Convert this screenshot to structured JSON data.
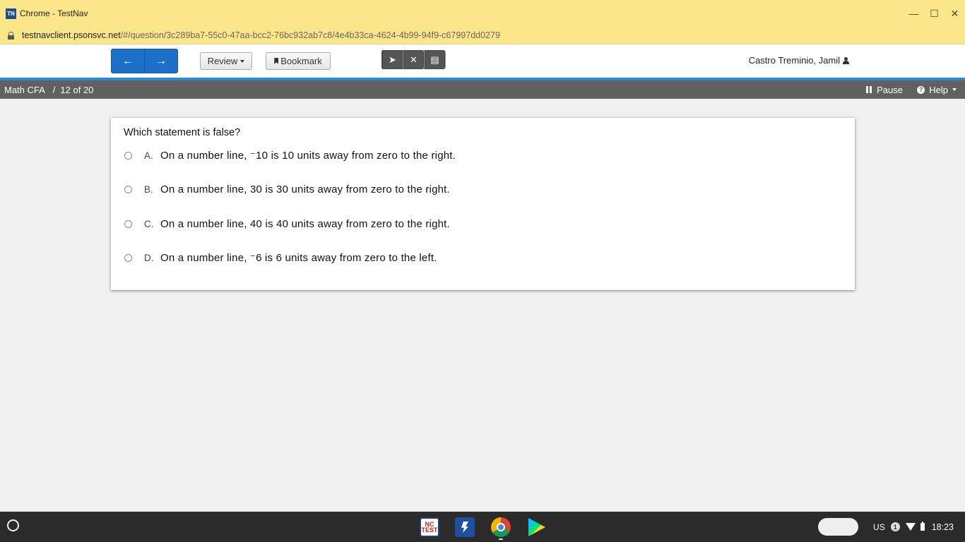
{
  "window": {
    "logo_text": "TN",
    "title": "Chrome - TestNav",
    "controls": {
      "minimize": "—",
      "maximize": "☐",
      "close": "✕"
    }
  },
  "urlbar": {
    "host": "testnavclient.psonsvc.net",
    "path": "/#/question/3c289ba7-55c0-47aa-bcc2-76bc932ab7c8/4e4b33ca-4624-4b99-94f9-c67997dd0279"
  },
  "toolbar": {
    "back_glyph": "←",
    "forward_glyph": "→",
    "review_label": "Review",
    "bookmark_label": "Bookmark",
    "tools": [
      {
        "name": "pointer-tool",
        "glyph": "➤",
        "icon": "pointer-icon"
      },
      {
        "name": "eliminator-tool",
        "glyph": "✕",
        "icon": "answer-eliminator-icon"
      },
      {
        "name": "notepad-tool",
        "glyph": "▤",
        "icon": "notepad-icon"
      }
    ],
    "user_name": "Castro Treminio, Jamil"
  },
  "secondary_bar": {
    "test_name": "Math CFA",
    "separator": "/",
    "progress": "12 of 20",
    "pause_label": "Pause",
    "help_label": "Help",
    "help_icon_glyph": "?"
  },
  "question": {
    "prompt": "Which statement is false?",
    "options": [
      {
        "letter": "A.",
        "text": "On a number line, ⁻10 is 10 units away from zero to the right."
      },
      {
        "letter": "B.",
        "text": "On a number line, 30 is 30 units away from zero to the right."
      },
      {
        "letter": "C.",
        "text": "On a number line, 40 is 40 units away from zero to the right."
      },
      {
        "letter": "D.",
        "text": "On a number line, ⁻6 is 6 units away from zero to the left."
      }
    ]
  },
  "taskbar": {
    "nc_app_label": "NC\nTEST",
    "keyboard_layout": "US",
    "notification_count": "1",
    "time": "18:23"
  }
}
